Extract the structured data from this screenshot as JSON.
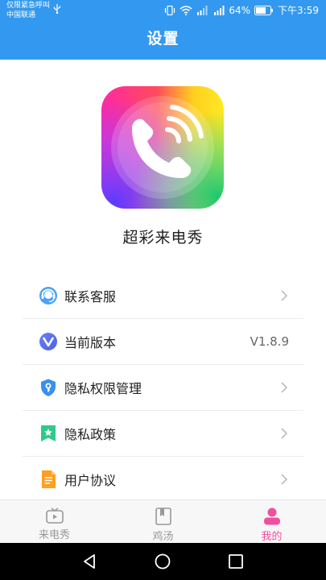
{
  "status_bar": {
    "emergency_text": "仅限紧急呼叫",
    "carrier": "中国联通",
    "battery": "64%",
    "time": "下午3:59"
  },
  "header": {
    "title": "设置"
  },
  "app": {
    "name": "超彩来电秀"
  },
  "menu": {
    "items": [
      {
        "label": "联系客服",
        "icon": "customer-service-icon"
      },
      {
        "label": "当前版本",
        "icon": "version-icon",
        "value": "V1.8.9"
      },
      {
        "label": "隐私权限管理",
        "icon": "shield-icon"
      },
      {
        "label": "隐私政策",
        "icon": "bookmark-star-icon"
      },
      {
        "label": "用户协议",
        "icon": "document-icon"
      }
    ]
  },
  "tabbar": {
    "tabs": [
      {
        "label": "来电秀",
        "icon": "tv-play-icon",
        "active": false
      },
      {
        "label": "鸡汤",
        "icon": "book-icon",
        "active": false
      },
      {
        "label": "我的",
        "icon": "user-icon",
        "active": true
      }
    ]
  },
  "colors": {
    "primary": "#3399f0",
    "active_tab": "#f0509e",
    "inactive_tab": "#999999"
  }
}
